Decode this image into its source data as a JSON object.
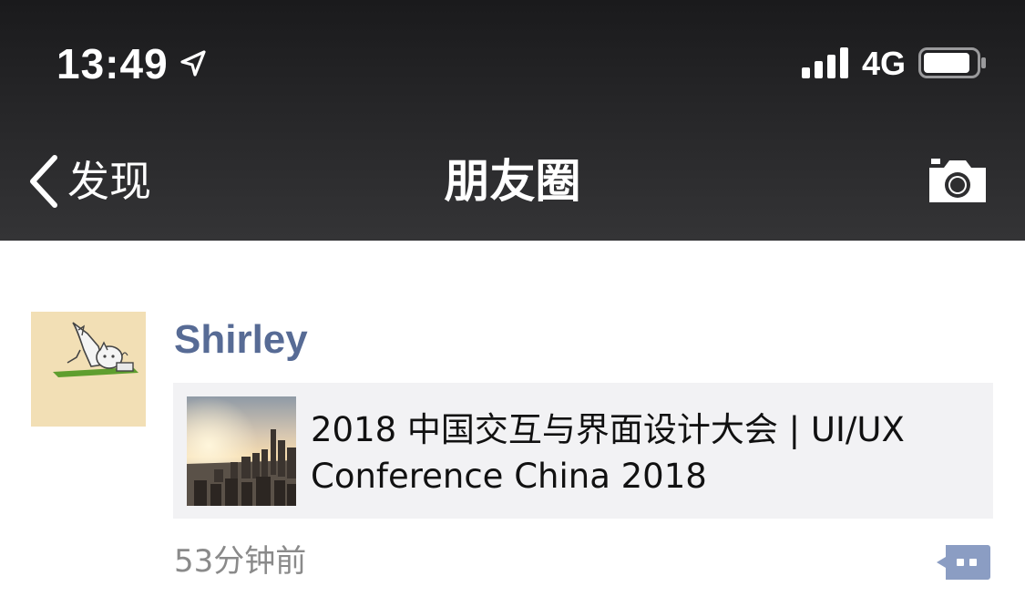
{
  "status_bar": {
    "time": "13:49",
    "network": "4G",
    "icons": [
      "location-arrow-icon",
      "signal-bars-icon",
      "battery-icon"
    ]
  },
  "nav": {
    "back_label": "发现",
    "title": "朋友圈",
    "icons": [
      "chevron-left-icon",
      "camera-icon"
    ]
  },
  "post": {
    "author": "Shirley",
    "link_title": "2018 中国交互与界面设计大会 | UI/UX Conference China 2018",
    "time": "53分钟前",
    "icons": [
      "avatar-image",
      "city-skyline-thumbnail",
      "comment-dots-icon"
    ]
  },
  "colors": {
    "nav_background": "#2a2a2c",
    "author_name": "#576b95",
    "link_card_background": "#f2f2f4",
    "timestamp": "#8a8a8a",
    "comment_button": "#8b9dc3"
  }
}
